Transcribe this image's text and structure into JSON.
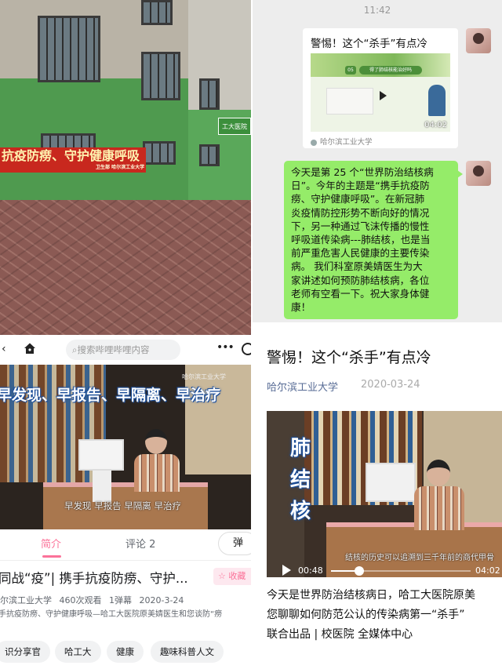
{
  "photo": {
    "banner_text": "抗疫防痨、守护健康呼吸",
    "banner_small": "卫生部 哈尔滨工业大学",
    "sign_text": "工大医院"
  },
  "chat": {
    "time": "11:42",
    "card": {
      "title": "警惕！这个“杀手”有点冷",
      "thumb_heading": "得了肺结核能治好吗",
      "thumb_badge": "05",
      "duration": "04:02",
      "source": "哈尔滨工业大学"
    },
    "message_lines": [
      "今天是第 25 个“世界防治结核病",
      "日”。今年的主题是“携手抗疫防",
      "痨、守护健康呼吸”。在新冠肺",
      "炎疫情防控形势不断向好的情况",
      "下，另一种通过飞沫传播的慢性",
      "呼吸道传染病---肺结核，也是当",
      "前严重危害人民健康的主要传染",
      "病。 我们科室原美婧医生为大",
      "家讲述如何预防肺结核病，各位",
      "老师有空看一下。祝大家身体健",
      "康！"
    ]
  },
  "bilibili": {
    "search_placeholder": "搜索哔哩哔哩内容",
    "video_overlay_title": "早发现、早报告、早隔离、早治疗",
    "video_subtitle": "早发现 早报告 早隔离 早治疗",
    "video_watermark": "哈尔滨工业大学",
    "tab_intro": "简介",
    "tab_comment": "评论 2",
    "danmu_label": "弹",
    "title": "同战“疫”| 携手抗疫防痨、守护...",
    "fav_label": "收藏",
    "meta": {
      "author": "尔滨工业大学",
      "views": "460次观看",
      "danmaku": "1弹幕",
      "date": "2020-3-24"
    },
    "desc": "手抗疫防痨、守护健康呼吸—哈工大医院原美婧医生和您谈防“痨",
    "tags": [
      "识分享官",
      "哈工大",
      "健康",
      "趣味科普人文"
    ]
  },
  "article": {
    "title": "警惕！这个“杀手”有点冷",
    "author": "哈尔滨工业大学",
    "date": "2020-03-24",
    "video": {
      "vertical_title": [
        "肺",
        "结",
        "核"
      ],
      "subtitle": "结核的历史可以追溯到三千年前的商代甲骨",
      "current_time": "00:48",
      "duration": "04:02",
      "progress": 0.2
    },
    "paragraph_lines": [
      "今天是世界防治结核病日，哈工大医院原美",
      "您聊聊如何防范公认的传染病第一“杀手”",
      "联合出品 | 校医院 全媒体中心"
    ]
  },
  "colors": {
    "wechat_green_bubble": "#95ec69",
    "bilibili_pink": "#fb7299",
    "wechat_link_blue": "#576b95",
    "banner_red": "#c8281e"
  }
}
